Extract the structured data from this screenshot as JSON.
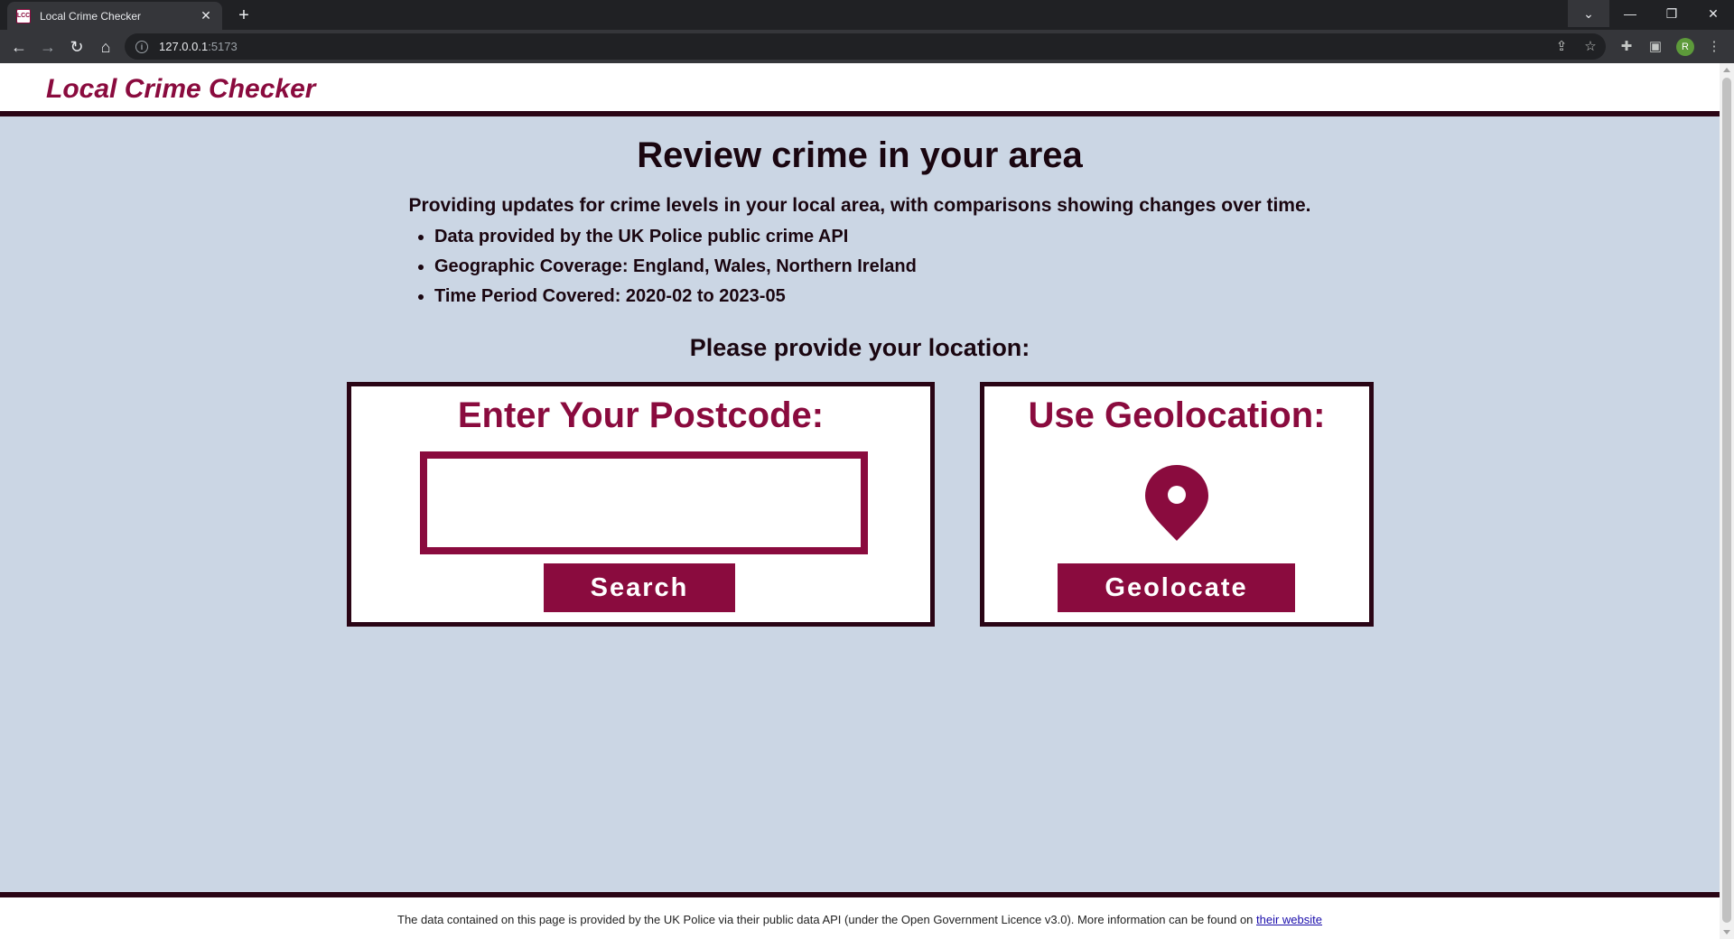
{
  "browser": {
    "tab_title": "Local Crime Checker",
    "favicon_text": "LCC",
    "url_host": "127.0.0.1",
    "url_port": ":5173",
    "profile_initial": "R",
    "icons": [
      "back-arrow-icon",
      "forward-arrow-icon",
      "reload-icon",
      "home-icon",
      "info-icon",
      "share-icon",
      "star-icon",
      "extensions-icon",
      "side-panel-icon",
      "menu-icon"
    ]
  },
  "header": {
    "site_title": "Local Crime Checker"
  },
  "main": {
    "title": "Review crime in your area",
    "intro": "Providing updates for crime levels in your local area, with comparisons showing changes over time.",
    "bullets": [
      "Data provided by the UK Police public crime API",
      "Geographic Coverage: England, Wales, Northern Ireland",
      "Time Period Covered: 2020-02 to 2023-05"
    ],
    "prompt": "Please provide your location:"
  },
  "postcode_card": {
    "title": "Enter Your Postcode:",
    "input_value": "",
    "button_label": "Search"
  },
  "geo_card": {
    "title": "Use Geolocation:",
    "icon": "location-pin-icon",
    "button_label": "Geolocate"
  },
  "footer": {
    "text": "The data contained on this page is provided by the UK Police via their public data API (under the Open Government Licence v3.0). More information can be found on ",
    "link_text": "their website"
  },
  "colors": {
    "accent": "#8a0b3e",
    "dark": "#2a0515",
    "background": "#cbd6e4"
  }
}
